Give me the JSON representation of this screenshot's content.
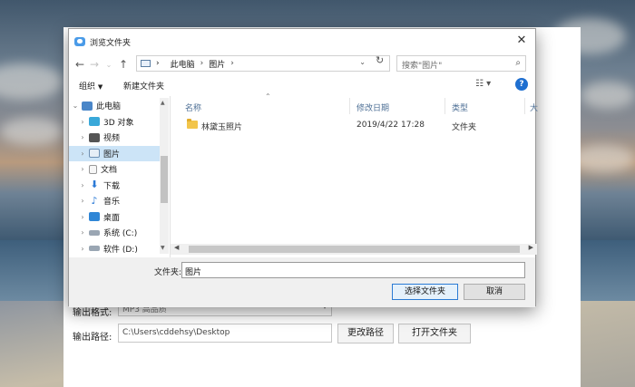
{
  "background_app": {
    "format_label": "输出格式:",
    "format_value": "MP3 高品质",
    "path_label": "输出路径:",
    "path_value": "C:\\Users\\cddehsy\\Desktop",
    "change_path_button": "更改路径",
    "open_folder_button": "打开文件夹"
  },
  "dialog": {
    "title": "浏览文件夹",
    "breadcrumb": [
      "此电脑",
      "图片"
    ],
    "search_placeholder": "搜索\"图片\"",
    "toolbar": {
      "organize": "组织",
      "new_folder": "新建文件夹"
    },
    "tree": [
      {
        "label": "此电脑",
        "icon": "pc-icon"
      },
      {
        "label": "3D 对象",
        "icon": "3d-objects-icon"
      },
      {
        "label": "视频",
        "icon": "video-icon"
      },
      {
        "label": "图片",
        "icon": "pictures-icon"
      },
      {
        "label": "文档",
        "icon": "documents-icon"
      },
      {
        "label": "下载",
        "icon": "download-icon"
      },
      {
        "label": "音乐",
        "icon": "music-icon"
      },
      {
        "label": "桌面",
        "icon": "desktop-icon"
      },
      {
        "label": "系统 (C:)",
        "icon": "drive-icon"
      },
      {
        "label": "软件 (D:)",
        "icon": "drive-icon"
      }
    ],
    "columns": [
      "名称",
      "修改日期",
      "类型",
      "大"
    ],
    "files": [
      {
        "name": "林黛玉照片",
        "modified": "2019/4/22 17:28",
        "type": "文件夹"
      }
    ],
    "folder_label": "文件夹:",
    "folder_value": "图片",
    "select_button": "选择文件夹",
    "cancel_button": "取消",
    "colors": {
      "accent": "#2a7bd4",
      "selected": "#cce4f7",
      "folder": "#f2c54b"
    }
  }
}
